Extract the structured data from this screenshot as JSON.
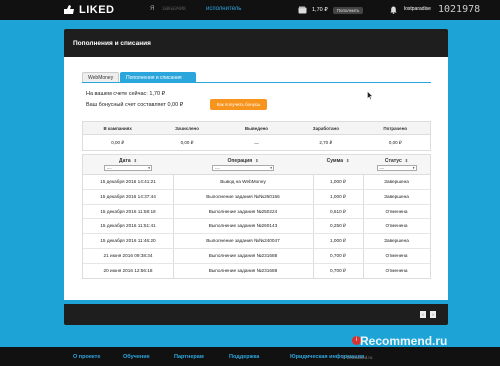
{
  "topbar": {
    "logo": "LIKED",
    "role_separator": "Я",
    "role_advertiser": "заказчик",
    "role_executor": "исполнитель",
    "balance": "1,70 ₽",
    "add_funds_label": "Пополнить",
    "username": "lostparadise",
    "overlay_badge": "1021978"
  },
  "page": {
    "title": "Пополнения и списания"
  },
  "tabs": [
    {
      "label": "WebMoney"
    },
    {
      "label": "Пополнения и списания"
    }
  ],
  "account": {
    "balance_line": "На вашем счете сейчас: 1,70 ₽",
    "bonus_line": "Ваш бонусный счет составляет 0,00 ₽",
    "bonus_button": "Как получить бонусы"
  },
  "summary": {
    "headers": [
      "В кампаниях",
      "Зачислено",
      "Выведено",
      "Заработано",
      "Потрачено"
    ],
    "values": [
      "0,00 ₽",
      "0,00 ₽",
      "—",
      "2,70 ₽",
      "0,00 ₽"
    ]
  },
  "operations": {
    "headers": {
      "date": "Дата",
      "operation": "Операция",
      "sum": "Сумма",
      "status": "Статус"
    },
    "filters": {
      "date": "----",
      "operation": "----",
      "status": "----"
    },
    "rows": [
      {
        "date": "15 декабря 2016 14:41:21",
        "op": "Вывод на WebMoney",
        "sum": "1,000 ₽",
        "status": "Завершена"
      },
      {
        "date": "15 декабря 2016 14:37:44",
        "op": "Выполнение задания №№260166",
        "sum": "1,000 ₽",
        "status": "Завершена"
      },
      {
        "date": "15 декабря 2016 11:58:18",
        "op": "Выполнение задания №250224",
        "sum": "0,610 ₽",
        "status": "Отменена"
      },
      {
        "date": "15 декабря 2016 11:51:41",
        "op": "Выполнение задания №260143",
        "sum": "0,250 ₽",
        "status": "Отменена"
      },
      {
        "date": "15 декабря 2016 11:46:20",
        "op": "Выполнение задания №№240047",
        "sum": "1,000 ₽",
        "status": "Завершена"
      },
      {
        "date": "21 июня 2016 09:38:34",
        "op": "Выполнение задания №231688",
        "sum": "0,700 ₽",
        "status": "Отменена"
      },
      {
        "date": "20 июня 2016 12:56:18",
        "op": "Выполнение задания №231688",
        "sum": "0,700 ₽",
        "status": "Отменена"
      }
    ]
  },
  "footer": {
    "links": [
      "О проекте",
      "Обучение",
      "Партнерам",
      "Поддержка",
      "Юридическая информация"
    ],
    "copyright": "© 2016 liked.ru",
    "watermark": "Recommend.ru"
  },
  "colors": {
    "background": "#1da3d6",
    "accent": "#2aa6dc",
    "bonus_button": "#f7941d",
    "dark": "#1e1e1e"
  },
  "icons": [
    "liked-logo-icon",
    "wallet-icon",
    "bell-icon",
    "sort-icon",
    "caret-down-icon",
    "cursor-icon",
    "prev-page-icon",
    "next-page-icon"
  ]
}
